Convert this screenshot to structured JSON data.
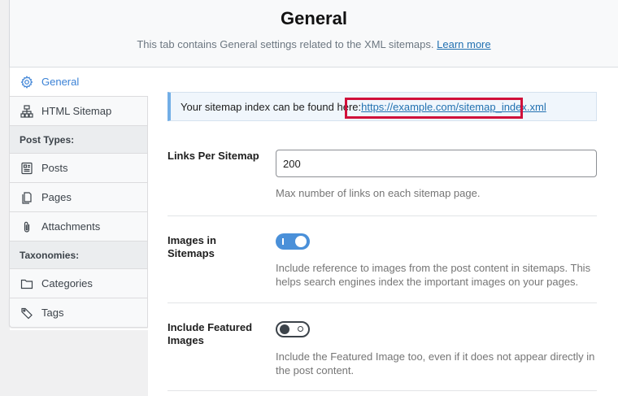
{
  "header": {
    "title": "General",
    "subtitle": "This tab contains General settings related to the XML sitemaps.",
    "learn_more": "Learn more"
  },
  "sidebar": {
    "items": [
      {
        "label": "General",
        "icon": "gear-icon",
        "active": true
      },
      {
        "label": "HTML Sitemap",
        "icon": "sitemap-icon"
      }
    ],
    "post_types_heading": "Post Types:",
    "post_types": [
      {
        "label": "Posts",
        "icon": "posts-icon"
      },
      {
        "label": "Pages",
        "icon": "pages-icon"
      },
      {
        "label": "Attachments",
        "icon": "paperclip-icon"
      }
    ],
    "taxonomies_heading": "Taxonomies:",
    "taxonomies": [
      {
        "label": "Categories",
        "icon": "folder-icon"
      },
      {
        "label": "Tags",
        "icon": "tag-icon"
      }
    ]
  },
  "notice": {
    "text": "Your sitemap index can be found here: ",
    "link": "https://example.com/sitemap_index.xml"
  },
  "links_per_sitemap": {
    "label": "Links Per Sitemap",
    "value": "200",
    "help": "Max number of links on each sitemap page."
  },
  "images_in_sitemaps": {
    "label": "Images in Sitemaps",
    "enabled": true,
    "help": "Include reference to images from the post content in sitemaps. This helps search engines index the important images on your pages."
  },
  "include_featured_images": {
    "label": "Include Featured Images",
    "enabled": false,
    "help": "Include the Featured Image too, even if it does not appear directly in the post content."
  },
  "colors": {
    "accent": "#3b82d6",
    "toggle_on": "#4a90d9",
    "highlight": "#d0103a"
  }
}
